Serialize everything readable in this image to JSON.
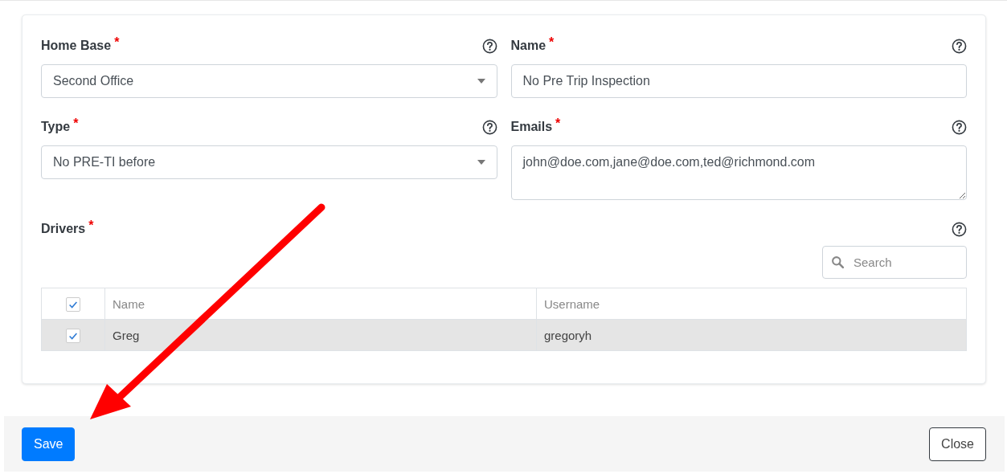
{
  "fields": [
    {
      "kind": "select",
      "label": "Home Base",
      "required_mark": "*",
      "value": "Second Office"
    },
    {
      "kind": "text",
      "label": "Name",
      "required_mark": "*",
      "value": "No Pre Trip Inspection"
    },
    {
      "kind": "select",
      "label": "Type",
      "required_mark": "*",
      "value": "No PRE-TI before"
    },
    {
      "kind": "textarea",
      "label": "Emails",
      "required_mark": "*",
      "value": "john@doe.com,jane@doe.com,ted@richmond.com"
    }
  ],
  "drivers": {
    "label": "Drivers",
    "required_mark": "*",
    "search": {
      "placeholder": "Search"
    },
    "table": {
      "all_checked": true,
      "columns": [
        "Name",
        "Username"
      ],
      "rows": [
        {
          "cells": [
            "Greg",
            "gregoryh"
          ],
          "checked": true,
          "selected": true
        }
      ]
    }
  },
  "footer": {
    "buttons": [
      {
        "label": "Save",
        "kind": "primary"
      },
      {
        "label": "Close",
        "kind": "secondary"
      }
    ]
  }
}
